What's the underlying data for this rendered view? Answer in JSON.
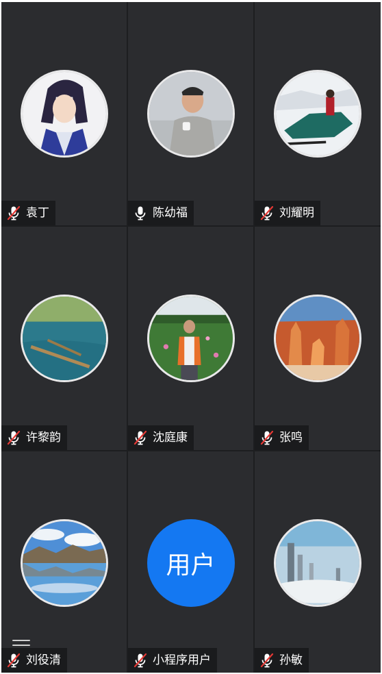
{
  "participants": [
    {
      "name": "袁丁",
      "muted": true,
      "avatar": "anime-portrait"
    },
    {
      "name": "陈幼福",
      "muted": false,
      "avatar": "man-with-cup-photo"
    },
    {
      "name": "刘耀明",
      "muted": true,
      "avatar": "snowmobile-photo"
    },
    {
      "name": "许黎韵",
      "muted": true,
      "avatar": "lake-photo"
    },
    {
      "name": "沈庭康",
      "muted": true,
      "avatar": "man-in-field-photo"
    },
    {
      "name": "张鸣",
      "muted": true,
      "avatar": "canyon-photo"
    },
    {
      "name": "刘役清",
      "muted": true,
      "avatar": "mountain-lake-photo"
    },
    {
      "name": "小程序用户",
      "muted": true,
      "avatar_text": "用户"
    },
    {
      "name": "孙敏",
      "muted": true,
      "avatar": "city-skyline-photo"
    }
  ],
  "colors": {
    "tile_bg": "#2b2c2f",
    "nameplate_bg": "#1a1b1d",
    "muted_mic": "#e53935",
    "text_avatar_bg": "#1478f2"
  },
  "icons": {
    "mic_muted": "microphone-muted-icon",
    "mic_on": "microphone-icon",
    "menu": "menu-icon"
  }
}
